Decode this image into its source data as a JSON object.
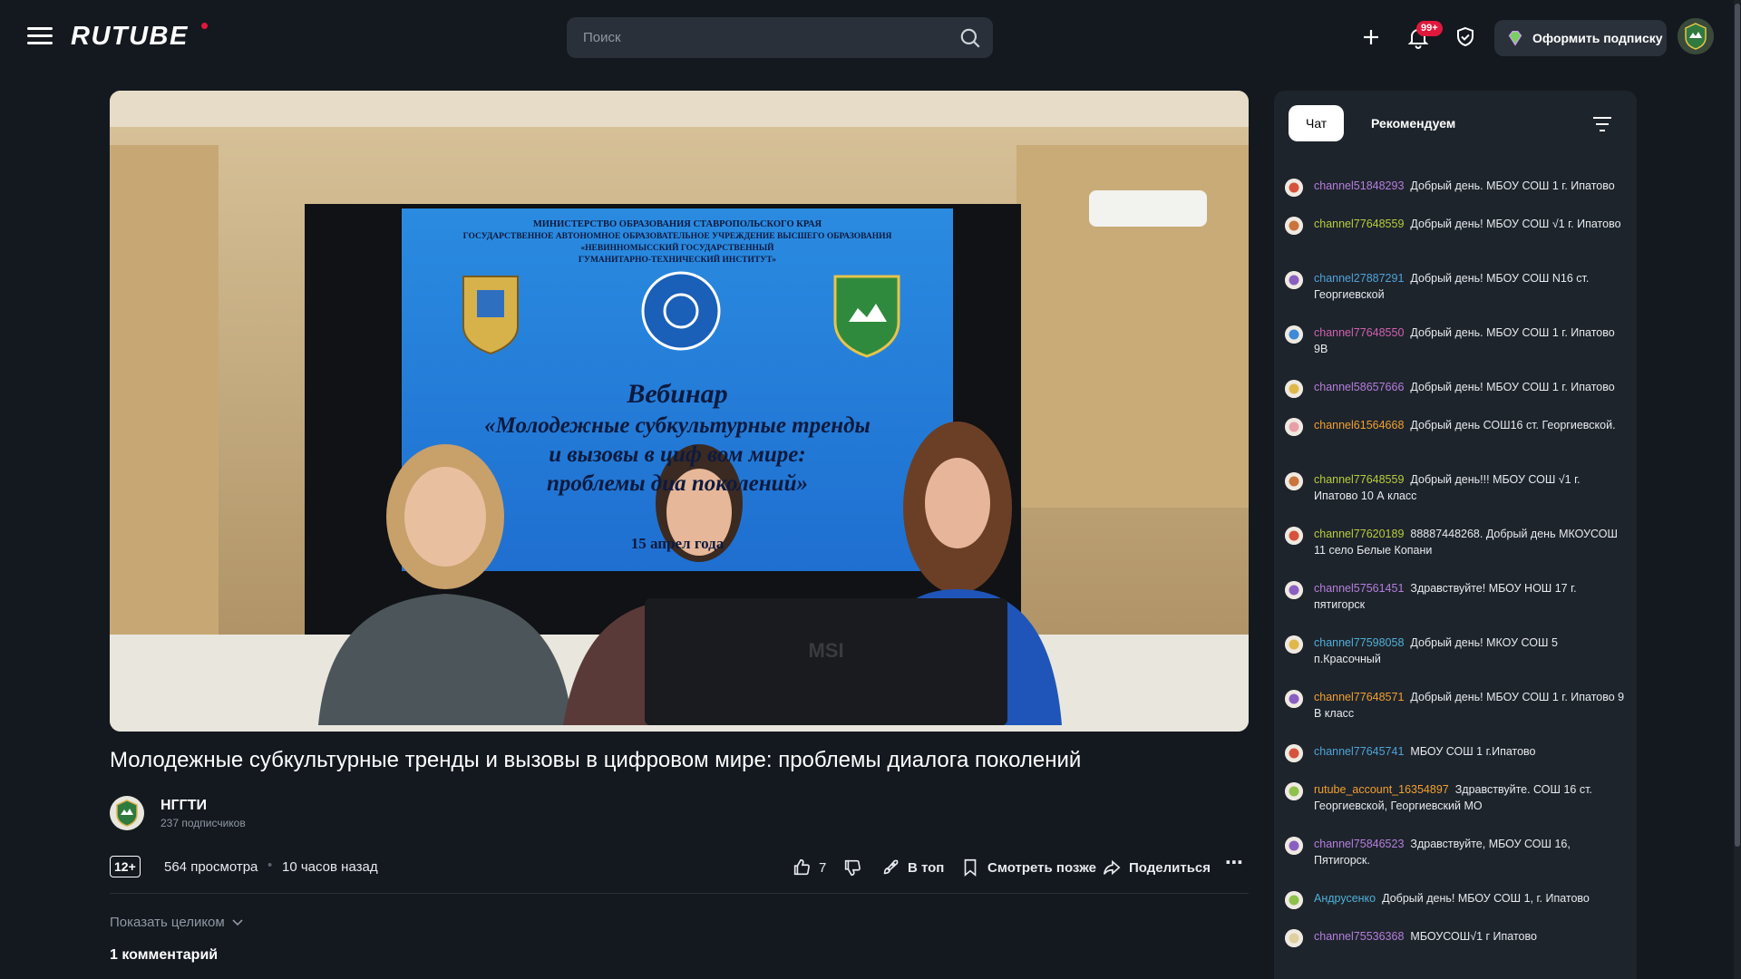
{
  "header": {
    "logo": "RUTUBE",
    "search_placeholder": "Поиск",
    "notifications_badge": "99+",
    "subscribe_label": "Оформить подписку",
    "colors": {
      "accent": "#e0183c",
      "background": "#14191f"
    }
  },
  "video": {
    "slide": {
      "ministry_line": "МИНИСТЕРСТВО ОБРАЗОВАНИЯ СТАВРОПОЛЬСКОГО КРАЯ",
      "institution_line1": "ГОСУДАРСТВЕННОЕ АВТОНОМНОЕ ОБРАЗОВАТЕЛЬНОЕ УЧРЕЖДЕНИЕ ВЫСШЕГО ОБРАЗОВАНИЯ",
      "institution_line2": "«НЕВИННОМЫССКИЙ ГОСУДАРСТВЕННЫЙ",
      "institution_line3": "ГУМАНИТАРНО-ТЕХНИЧЕСКИЙ ИНСТИТУТ»",
      "heading": "Вебинар",
      "line1": "«Молодежные субкультурные тренды",
      "line2": "и вызовы в циф  вом мире:",
      "line3": "проблемы диа  поколений»",
      "date": "15 апрел       года",
      "monitor_brand": "MSI"
    }
  },
  "title": "Молодежные субкультурные тренды и вызовы в цифровом мире: проблемы диалога поколений",
  "channel": {
    "name": "НГГТИ",
    "subscribers": "237 подписчиков"
  },
  "meta": {
    "age_rating": "12+",
    "views": "564 просмотра",
    "published": "10 часов назад"
  },
  "actions": {
    "likes": "7",
    "top_label": "В топ",
    "watch_later": "Смотреть позже",
    "share": "Поделиться"
  },
  "description": {
    "show_more": "Показать целиком"
  },
  "comments": {
    "count_label": "1 комментарий"
  },
  "chat": {
    "tabs": [
      "Чат",
      "Рекомендуем"
    ],
    "messages": [
      {
        "user": "channel51848293",
        "text": "Добрый день. МБОУ СОШ 1 г. Ипатово",
        "user_color": "#b57edc",
        "avatar_color": "#d6533b"
      },
      {
        "user": "channel77648559",
        "text": "Добрый день! МБОУ СОШ √1 г. Ипатово",
        "user_color": "#b7cc3d",
        "avatar_color": "#c9743b"
      },
      {
        "user": "channel27887291",
        "text": "Добрый день! МБОУ СОШ N16 ст. Георгиевской",
        "user_color": "#4fa3d8",
        "avatar_color": "#8a5fc0"
      },
      {
        "user": "channel77648550",
        "text": "Добрый день. МБОУ СОШ 1 г. Ипатово 9В",
        "user_color": "#d060b0",
        "avatar_color": "#3d8ad6"
      },
      {
        "user": "channel58657666",
        "text": "Добрый день! МБОУ СОШ 1 г. Ипатово",
        "user_color": "#b57edc",
        "avatar_color": "#e0b84a"
      },
      {
        "user": "channel61564668",
        "text": "Добрый день СОШ16 ст. Георгиевской.",
        "user_color": "#f0a030",
        "avatar_color": "#e8a0a8"
      },
      {
        "user": "channel77648559",
        "text": "Добрый день!!! МБОУ СОШ √1 г. Ипатово 10 А класс",
        "user_color": "#b7cc3d",
        "avatar_color": "#c9743b"
      },
      {
        "user": "channel77620189",
        "text": "88887448268. Добрый день МКОУСОШ 11 село Белые Копани",
        "user_color": "#b7cc3d",
        "avatar_color": "#d6533b"
      },
      {
        "user": "channel57561451",
        "text": "Здравствуйте! МБОУ НОШ 17 г. пятигорск",
        "user_color": "#b57edc",
        "avatar_color": "#8a5fc0"
      },
      {
        "user": "channel77598058",
        "text": "Добрый день! МКОУ СОШ 5 п.Красочный",
        "user_color": "#4fb0d8",
        "avatar_color": "#e0b84a"
      },
      {
        "user": "channel77648571",
        "text": "Добрый день! МБОУ СОШ 1 г. Ипатово 9 В класс",
        "user_color": "#f0a030",
        "avatar_color": "#8a5fc0"
      },
      {
        "user": "channel77645741",
        "text": "МБОУ СОШ 1 г.Ипатово",
        "user_color": "#4fa3d8",
        "avatar_color": "#d6533b"
      },
      {
        "user": "rutube_account_16354897",
        "text": "Здравствуйте. СОШ 16 ст. Георгиевской, Георгиевский МО",
        "user_color": "#f0a030",
        "avatar_color": "#8fc04a"
      },
      {
        "user": "channel75846523",
        "text": "Здравствуйте, МБОУ СОШ 16, Пятигорск.",
        "user_color": "#b57edc",
        "avatar_color": "#8a5fc0"
      },
      {
        "user": "Андрусенко",
        "text": "Добрый день! МБОУ СОШ 1, г. Ипатово",
        "user_color": "#4fb0d8",
        "avatar_color": "#8fc04a"
      },
      {
        "user": "channel75536368",
        "text": "МБОУСОШ√1 г Ипатово",
        "user_color": "#b57edc",
        "avatar_color": "#e0d0a0"
      }
    ]
  }
}
